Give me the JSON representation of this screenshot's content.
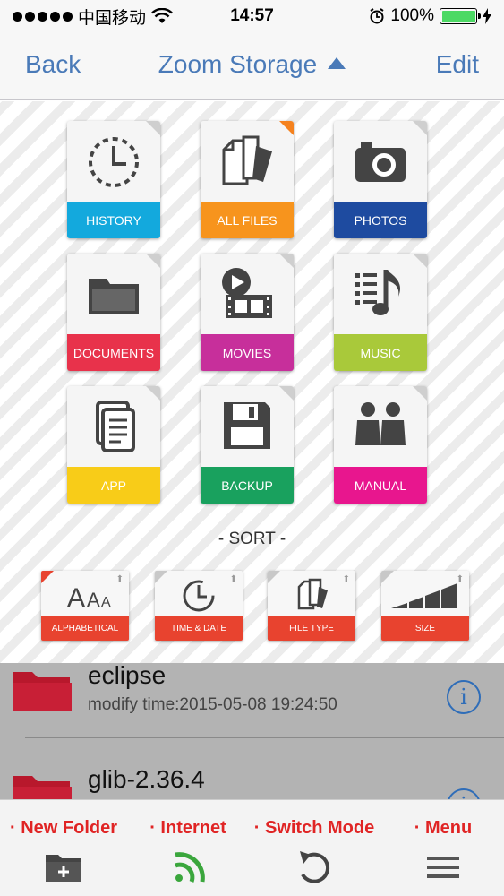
{
  "status_bar": {
    "carrier": "中国移动",
    "time": "14:57",
    "battery": "100%"
  },
  "nav": {
    "back": "Back",
    "title": "Zoom Storage",
    "edit": "Edit"
  },
  "categories": [
    {
      "label": "HISTORY",
      "color": "#13a9dd",
      "icon": "clock-dashed-icon"
    },
    {
      "label": "ALL FILES",
      "color": "#f7941d",
      "icon": "files-icon"
    },
    {
      "label": "PHOTOS",
      "color": "#1e4ba0",
      "icon": "camera-icon"
    },
    {
      "label": "DOCUMENTS",
      "color": "#e8324b",
      "icon": "folder-icon"
    },
    {
      "label": "MOVIES",
      "color": "#c72f9b",
      "icon": "movie-icon"
    },
    {
      "label": "MUSIC",
      "color": "#a9c93a",
      "icon": "music-icon"
    },
    {
      "label": "APP",
      "color": "#f8cc18",
      "icon": "document-icon"
    },
    {
      "label": "BACKUP",
      "color": "#19a15e",
      "icon": "floppy-icon"
    },
    {
      "label": "MANUAL",
      "color": "#e8168e",
      "icon": "people-icon"
    }
  ],
  "sort": {
    "title": "- SORT -",
    "options": [
      {
        "label": "ALPHABETICAL",
        "icon": "alphabet-icon"
      },
      {
        "label": "TIME & DATE",
        "icon": "clock-icon"
      },
      {
        "label": "FILE TYPE",
        "icon": "file-type-icon"
      },
      {
        "label": "SIZE",
        "icon": "size-bars-icon"
      }
    ]
  },
  "files": [
    {
      "name": "eclipse",
      "meta": "modify time:2015-05-08 19:24:50"
    },
    {
      "name": "glib-2.36.4",
      "meta": ""
    }
  ],
  "toolbar": {
    "new_folder": "· New Folder",
    "internet": "· Internet",
    "switch_mode": "· Switch Mode",
    "menu": "· Menu"
  },
  "colors": {
    "accent_blue": "#4a7ab8",
    "toolbar_red": "#e02424",
    "sort_red": "#e8432f",
    "folder_red": "#b8182c"
  }
}
